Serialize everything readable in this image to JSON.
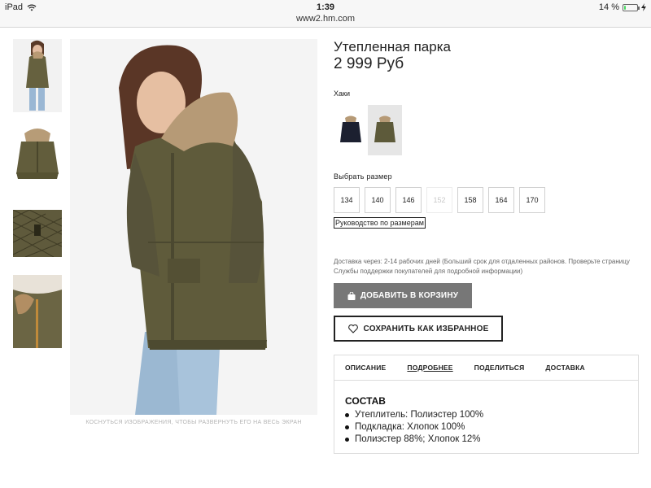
{
  "status_bar": {
    "device": "iPad",
    "time": "1:39",
    "url": "www2.hm.com",
    "battery_percent": "14 %",
    "battery_level": 0.14
  },
  "gallery": {
    "caption": "КОСНУТЬСЯ ИЗОБРАЖЕНИЯ, ЧТОБЫ РАЗВЕРНУТЬ ЕГО НА ВЕСЬ ЭКРАН"
  },
  "product": {
    "title": "Утепленная парка",
    "price": "2 999 Руб",
    "color_name": "Хаки",
    "swatches": [
      "navy",
      "khaki"
    ],
    "size_label": "Выбрать размер",
    "sizes": [
      "134",
      "140",
      "146",
      "152",
      "158",
      "164",
      "170"
    ],
    "size_guide": "Руководство по размерам",
    "delivery": "Доставка через: 2-14 рабочих дней (Больший срок для отдаленных районов. Проверьте страницу Службы поддержки покупателей для подробной информации)",
    "add_to_cart": "ДОБАВИТЬ В КОРЗИНУ",
    "save_favorite": "СОХРАНИТЬ КАК ИЗБРАННОЕ"
  },
  "tabs": [
    "ОПИСАНИЕ",
    "ПОДРОБНЕЕ",
    "ПОДЕЛИТЬСЯ",
    "ДОСТАВКА"
  ],
  "composition": {
    "title": "СОСТАВ",
    "items": [
      "Утеплитель: Полиэстер 100%",
      "Подкладка: Хлопок 100%",
      "Полиэстер 88%; Хлопок 12%"
    ]
  },
  "colors": {
    "khaki": "#5d5a3a",
    "navy": "#1c2030",
    "button_gray": "#777777"
  }
}
